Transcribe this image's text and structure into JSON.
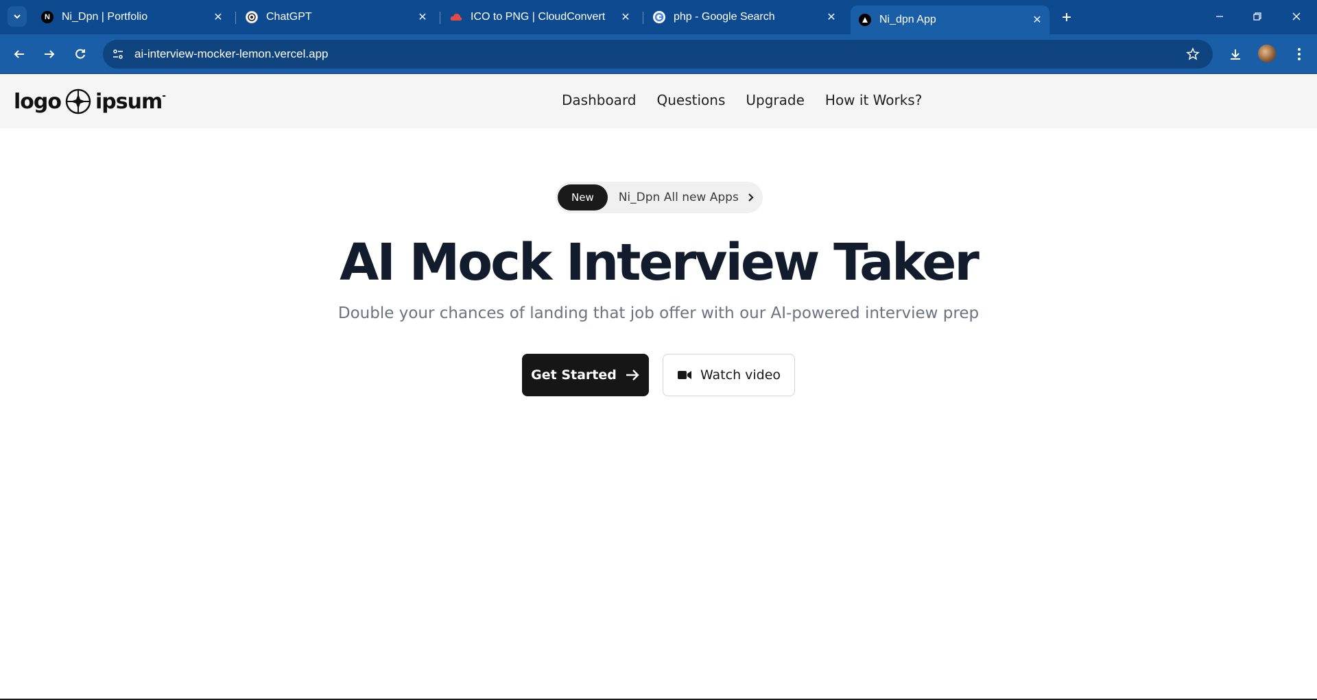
{
  "browser": {
    "tabs": [
      {
        "favicon": "N",
        "title": "Ni_Dpn | Portfolio",
        "active": false
      },
      {
        "favicon": "chatgpt-icon",
        "title": "ChatGPT",
        "active": false
      },
      {
        "favicon": "cloudconvert-icon",
        "title": "ICO to PNG | CloudConvert",
        "active": false
      },
      {
        "favicon": "google-icon",
        "title": "php - Google Search",
        "active": false
      },
      {
        "favicon": "vercel-icon",
        "title": "Ni_dpn App",
        "active": true
      }
    ],
    "url": "ai-interview-mocker-lemon.vercel.app",
    "accent": "#1a5ea8"
  },
  "site": {
    "logo": {
      "left": "logo",
      "right": "ipsum"
    },
    "nav": [
      "Dashboard",
      "Questions",
      "Upgrade",
      "How it Works?"
    ],
    "announcement": {
      "badge": "New",
      "text": "Ni_Dpn All new Apps"
    },
    "hero": {
      "title": "AI Mock Interview Taker",
      "subtitle": "Double your chances of landing that job offer with our AI-powered interview prep"
    },
    "cta": {
      "primary": "Get Started",
      "secondary": "Watch video"
    }
  }
}
